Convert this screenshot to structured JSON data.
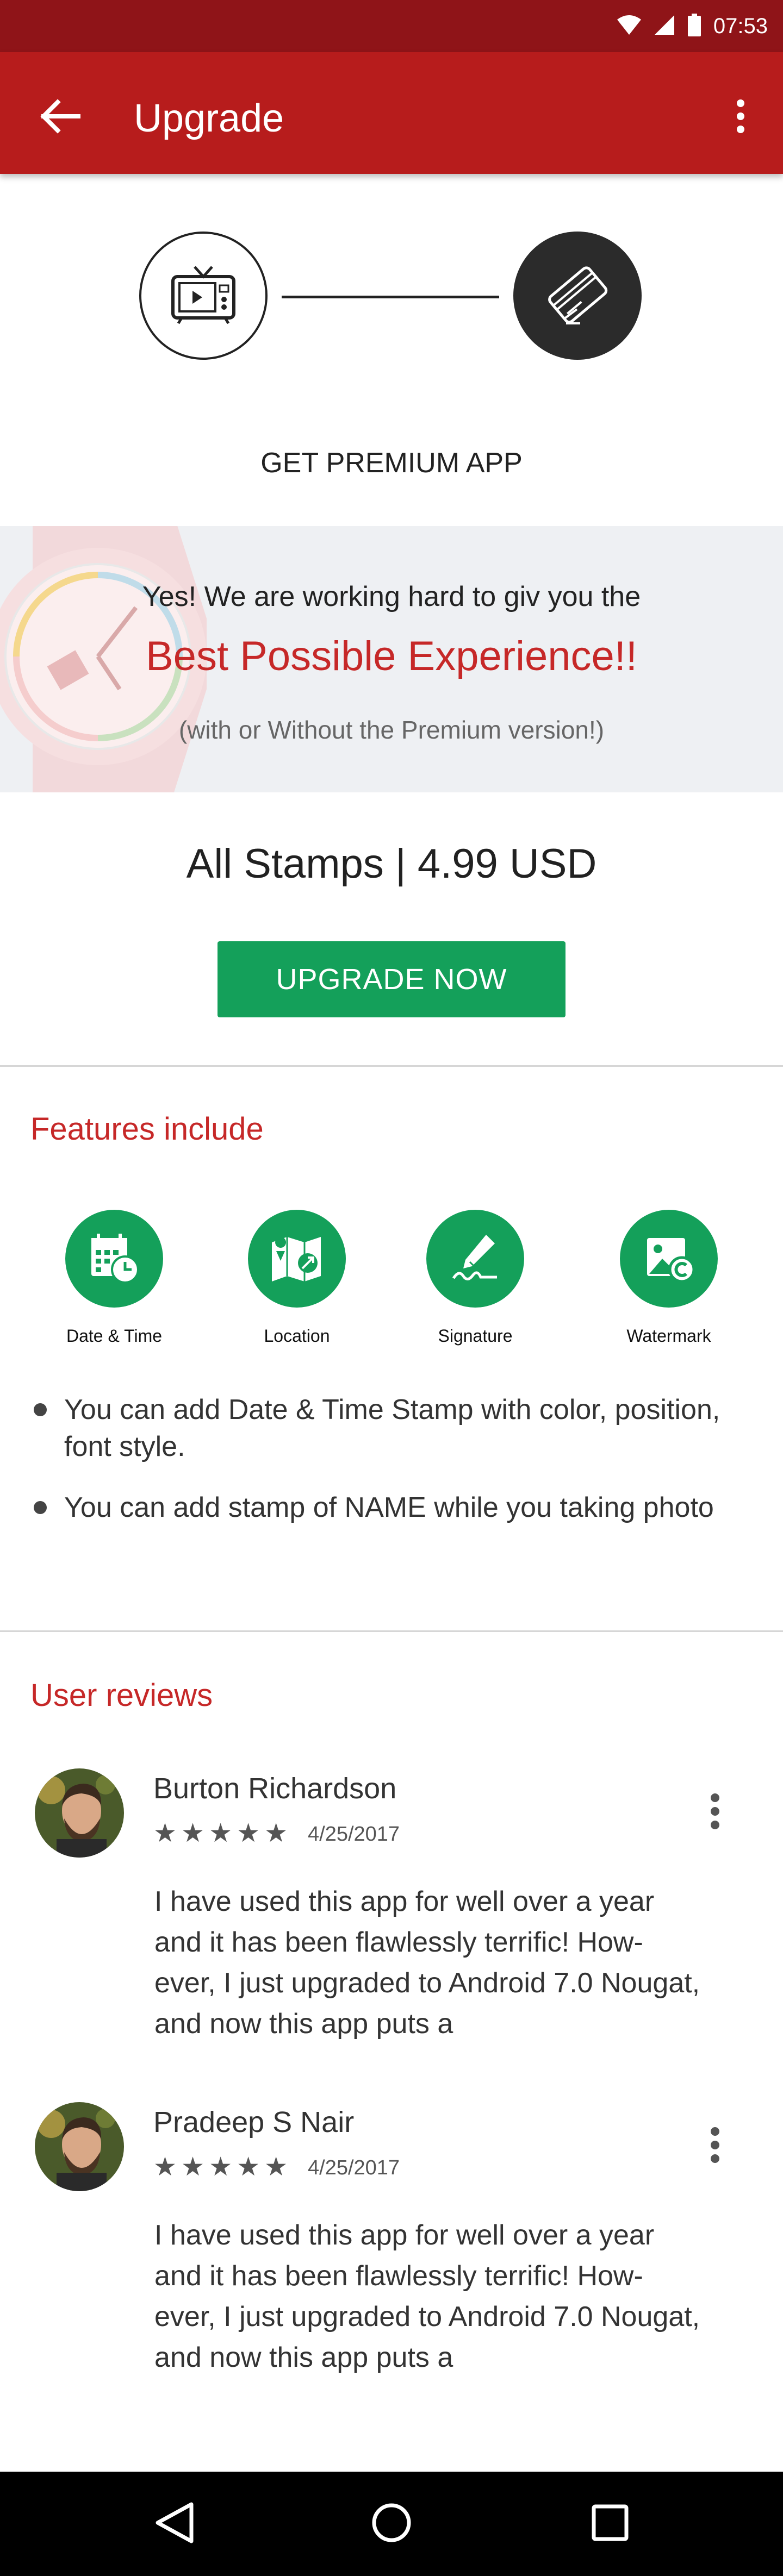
{
  "status_bar": {
    "time": "07:53"
  },
  "app_bar": {
    "title": "Upgrade"
  },
  "premium": {
    "label": "GET PREMIUM APP"
  },
  "banner": {
    "line1": "Yes! We are working hard to giv you the",
    "line2": "Best Possible Experience!!",
    "line3": "(with or Without the Premium version!)"
  },
  "pricing": {
    "price_text": "All Stamps | 4.99 USD",
    "button_label": "UPGRADE NOW"
  },
  "features": {
    "title": "Features include",
    "items": [
      {
        "label": "Date & Time",
        "icon": "calendar-clock-icon"
      },
      {
        "label": "Location",
        "icon": "map-location-icon"
      },
      {
        "label": "Signature",
        "icon": "signature-pen-icon"
      },
      {
        "label": "Watermark",
        "icon": "watermark-image-icon"
      }
    ],
    "bullets": [
      "You can add Date & Time Stamp with color, position, font style.",
      "You can add stamp of NAME while you taking photo"
    ]
  },
  "reviews": {
    "title": "User reviews",
    "items": [
      {
        "name": "Burton Richardson",
        "rating": 5,
        "date": "4/25/2017",
        "text": "I have used this app for well over a year and it has been flawlessly terrific! How-ever, I just upgraded to Android 7.0 Nougat, and now this app puts a"
      },
      {
        "name": "Pradeep S Nair",
        "rating": 5,
        "date": "4/25/2017",
        "text": "I have used this app for well over a year and it has been flawlessly terrific! How-ever, I just upgraded to Android 7.0 Nougat, and now this app puts a"
      }
    ]
  },
  "colors": {
    "status_bar": "#8f1418",
    "app_bar": "#b71c1c",
    "accent_red": "#c62828",
    "accent_green": "#14a05a"
  }
}
